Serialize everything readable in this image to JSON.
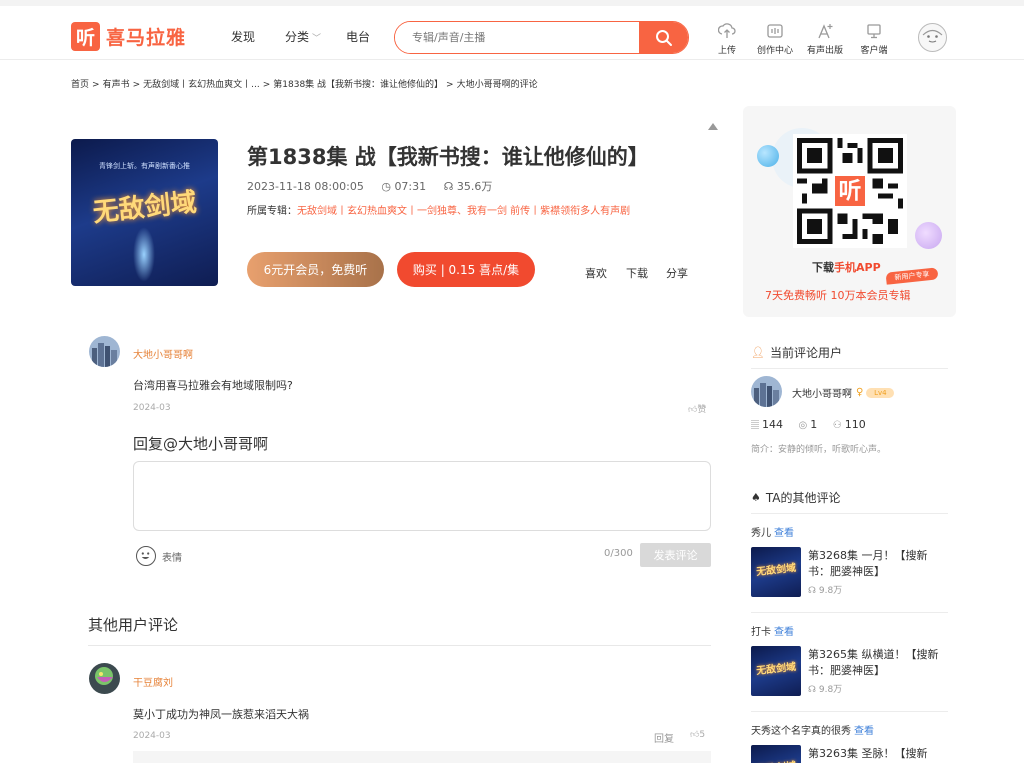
{
  "header": {
    "logo_mark": "听",
    "logo_text": "喜马拉雅",
    "nav": {
      "find": "发现",
      "category": "分类",
      "radio": "电台"
    },
    "search_placeholder": "专辑/声音/主播",
    "tools": {
      "upload": "上传",
      "creator": "创作中心",
      "publish": "有声出版",
      "client": "客户端"
    }
  },
  "breadcrumb": [
    "首页",
    "有声书",
    "无敌剑域丨玄幻热血爽文丨...",
    "第1838集 战【我新书搜：谁让他修仙的】",
    "大地小哥哥啊的评论"
  ],
  "episode": {
    "cover_title": "无敌剑域",
    "cover_sub": "青锋剑上斩。有声剧新番心推",
    "title": "第1838集 战【我新书搜：谁让他修仙的】",
    "date": "2023-11-18 08:00:05",
    "duration": "07:31",
    "plays": "35.6万",
    "album_label": "所属专辑：",
    "album_name": "无敌剑域丨玄幻热血爽文丨一剑独尊、我有一剑 前传丨紫襟领衔多人有声剧",
    "vip_button": "6元开会员，免费听",
    "buy_button": "购买 | 0.15 喜点/集",
    "actions": {
      "like": "喜欢",
      "download": "下载",
      "share": "分享"
    }
  },
  "main_comment": {
    "user": "大地小哥哥啊",
    "text": "台湾用喜马拉雅会有地域限制吗?",
    "date": "2024-03",
    "like": "赞"
  },
  "reply": {
    "title": "回复@大地小哥哥啊",
    "emoji_label": "表情",
    "counter": "0/300",
    "send": "发表评论"
  },
  "others": {
    "title": "其他用户评论",
    "comments": [
      {
        "user": "干豆腐刘",
        "text": "莫小丁成功为神凤一族惹来滔天大祸",
        "date": "2024-03",
        "reply": "回复",
        "likes": "5"
      }
    ]
  },
  "sidebar": {
    "download_prefix": "下载",
    "download_app": "手机APP",
    "vip_tag": "新用户专享",
    "promo": "7天免费畅听   10万本会员专辑",
    "current_user_title": "当前评论用户",
    "user_name": "大地小哥哥啊",
    "user_level": "Lv4",
    "stats": {
      "tracks": "144",
      "albums": "1",
      "fans": "110"
    },
    "intro": "简介：安静的倾听，听歌听心声。",
    "other_comments_title": "TA的其他评论",
    "other_comments": [
      {
        "text": "秀儿",
        "see": "查看",
        "title": "第3268集 一月！【搜新书：肥婆神医】",
        "plays": "9.8万"
      },
      {
        "text": "打卡",
        "see": "查看",
        "title": "第3265集 纵横道！【搜新书：肥婆神医】",
        "plays": "9.8万"
      },
      {
        "text": "天秀这个名字真的很秀",
        "see": "查看",
        "title": "第3263集 圣脉！【搜新",
        "plays": ""
      }
    ]
  }
}
